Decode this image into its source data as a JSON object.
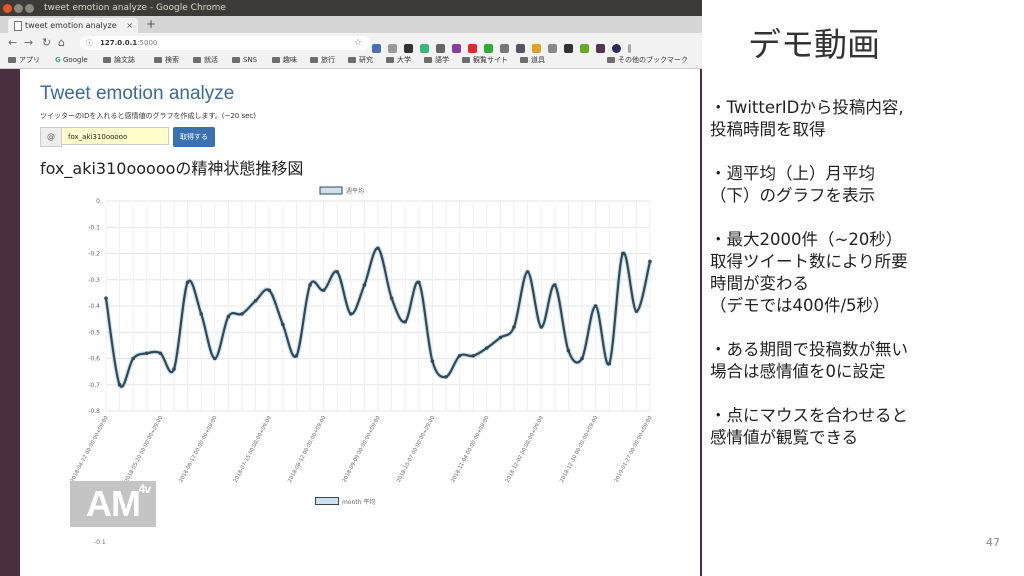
{
  "browser": {
    "window_title": "tweet emotion analyze - Google Chrome",
    "tab_title": "tweet emotion analyze",
    "url": "127.0.0.1:5000",
    "url_host": "127.0.0.1",
    "url_port": ":5000",
    "bookmarks": [
      "アプリ",
      "Google",
      "論文誌",
      "検索",
      "就活",
      "SNS",
      "趣味",
      "旅行",
      "研究",
      "大学",
      "語学",
      "観覧サイト",
      "道具"
    ],
    "other_bookmarks": "その他のブックマーク"
  },
  "page": {
    "app_title": "Tweet emotion analyze",
    "description": "ツイッターのIDを入れると感情値のグラフを作成します。(~20 sec)",
    "at_symbol": "@",
    "input_value": "fox_aki310ooooo",
    "submit_label": "取得する",
    "heading": "fox_aki310oooooの精神状態推移図",
    "logo_text": "AM",
    "logo_sup": "4v",
    "legend2": "month 平均",
    "y2_label": "-0.1"
  },
  "chart_data": {
    "type": "line",
    "legend": "週平均",
    "ylim": [
      -0.8,
      0
    ],
    "yticks": [
      "0",
      "-0.1",
      "-0.2",
      "-0.3",
      "-0.4",
      "-0.5",
      "-0.6",
      "-0.7",
      "-0.8"
    ],
    "x_tick_labels": [
      "2018-04-22 00:00:00+09:00",
      "2018-05-20 00:00:00+09:00",
      "2018-06-17 00:00:00+09:00",
      "2018-07-15 00:00:00+09:00",
      "2018-08-12 00:00:00+09:00",
      "2018-09-09 00:00:00+09:00",
      "2018-10-07 00:00:00+09:00",
      "2018-11-04 00:00:00+09:00",
      "2018-12-02 00:00:00+09:00",
      "2018-12-30 00:00:00+09:00",
      "2019-01-27 00:00:00+09:00"
    ],
    "values": [
      -0.37,
      -0.7,
      -0.6,
      -0.58,
      -0.58,
      -0.64,
      -0.31,
      -0.43,
      -0.6,
      -0.44,
      -0.43,
      -0.38,
      -0.34,
      -0.47,
      -0.59,
      -0.32,
      -0.34,
      -0.27,
      -0.43,
      -0.32,
      -0.18,
      -0.37,
      -0.46,
      -0.31,
      -0.61,
      -0.67,
      -0.59,
      -0.59,
      -0.56,
      -0.52,
      -0.48,
      -0.27,
      -0.48,
      -0.32,
      -0.57,
      -0.6,
      -0.4,
      -0.62,
      -0.2,
      -0.42,
      -0.23
    ],
    "grid": true,
    "legend_position": "top-center",
    "colors": {
      "line": "#2e4a5a"
    }
  },
  "slide": {
    "title": "デモ動画",
    "bullets": [
      [
        "・TwitterIDから投稿内容,",
        "投稿時間を取得"
      ],
      [
        "・週平均（上）月平均",
        "（下）のグラフを表示"
      ],
      [
        "・最大2000件（~20秒）",
        "取得ツイート数により所要",
        "時間が変わる",
        "（デモでは400件/5秒）"
      ],
      [
        "・ある期間で投稿数が無い",
        "場合は感情値を0に設定"
      ],
      [
        "・点にマウスを合わせると",
        "感情値が観覧できる"
      ]
    ],
    "page_number": "47"
  }
}
